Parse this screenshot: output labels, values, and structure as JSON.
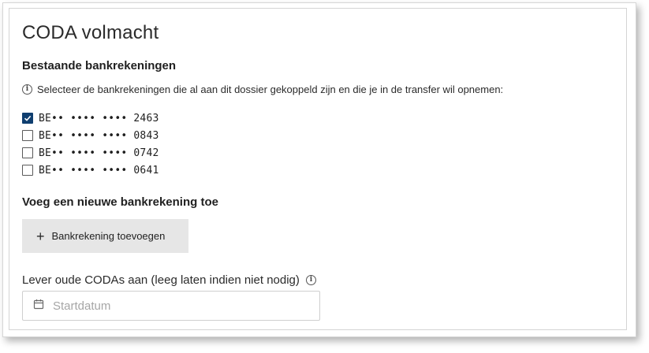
{
  "card": {
    "title": "CODA volmacht"
  },
  "existing_accounts": {
    "heading": "Bestaande bankrekeningen",
    "info_text": "Selecteer de bankrekeningen die al aan dit dossier gekoppeld zijn en die je in de transfer wil opnemen:",
    "info_icon": "info-circle-icon",
    "accounts": [
      {
        "iban": "BE•• •••• •••• 2463",
        "checked": true
      },
      {
        "iban": "BE•• •••• •••• 0843",
        "checked": false
      },
      {
        "iban": "BE•• •••• •••• 0742",
        "checked": false
      },
      {
        "iban": "BE•• •••• •••• 0641",
        "checked": false
      }
    ]
  },
  "new_account": {
    "heading": "Voeg een nieuwe bankrekening toe",
    "button_label": "Bankrekening toevoegen",
    "button_icon": "plus-icon"
  },
  "old_codas": {
    "label": "Lever oude CODAs aan (leeg laten indien niet nodig)",
    "info_icon": "info-circle-icon",
    "date_icon": "calendar-icon",
    "date_value": "",
    "date_placeholder": "Startdatum"
  },
  "colors": {
    "checkbox_checked": "#0f3e6f",
    "button_background": "#e6e6e6",
    "placeholder": "#a6a6a6"
  }
}
